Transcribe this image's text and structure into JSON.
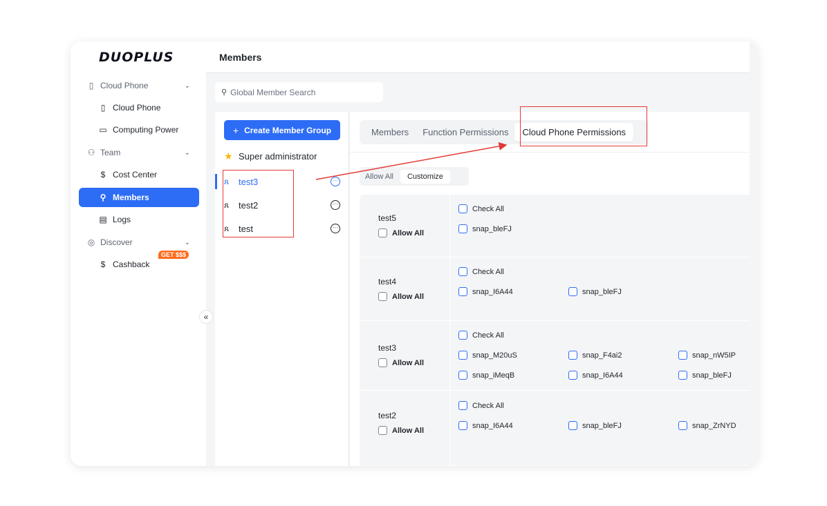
{
  "brand": {
    "logo": "DUOPLUS"
  },
  "sidebar": {
    "groups": [
      {
        "label": "Cloud Phone",
        "icon": "phone-outline-icon"
      },
      {
        "label": "Team",
        "icon": "team-icon"
      },
      {
        "label": "Discover",
        "icon": "compass-icon"
      }
    ],
    "items": [
      {
        "label": "Cloud Phone",
        "icon": "phone-icon"
      },
      {
        "label": "Computing Power",
        "icon": "monitor-icon"
      },
      {
        "label": "Cost Center",
        "icon": "dollar-circle-icon"
      },
      {
        "label": "Members",
        "icon": "members-icon"
      },
      {
        "label": "Logs",
        "icon": "document-icon"
      },
      {
        "label": "Cashback",
        "icon": "dollar-icon"
      }
    ],
    "cashback_badge": "GET $$$"
  },
  "header": {
    "title": "Members"
  },
  "search": {
    "placeholder": "Global Member Search"
  },
  "groups_panel": {
    "create_button": "Create Member Group",
    "super_admin": "Super administrator",
    "groups": [
      "test3",
      "test2",
      "test"
    ],
    "selected": "test3"
  },
  "tabs": [
    "Members",
    "Function Permissions",
    "Cloud Phone Permissions"
  ],
  "active_tab": "Cloud Phone Permissions",
  "segment": {
    "options": [
      "Allow All",
      "Customize"
    ],
    "active": "Customize"
  },
  "labels": {
    "allow_all": "Allow All",
    "check_all": "Check All"
  },
  "permissions": [
    {
      "member": "test5",
      "phones": [
        "snap_bleFJ"
      ]
    },
    {
      "member": "test4",
      "phones": [
        "snap_I6A44",
        "snap_bleFJ"
      ]
    },
    {
      "member": "test3",
      "phones": [
        "snap_M20uS",
        "snap_F4ai2",
        "snap_nW5IP",
        "snap_iMeqB",
        "snap_I6A44",
        "snap_bleFJ"
      ]
    },
    {
      "member": "test2",
      "phones": [
        "snap_I6A44",
        "snap_bleFJ",
        "snap_ZrNYD"
      ]
    }
  ],
  "colors": {
    "accent": "#2d6cf5",
    "annotation": "#e53935",
    "badge": "#ff6a1a"
  }
}
